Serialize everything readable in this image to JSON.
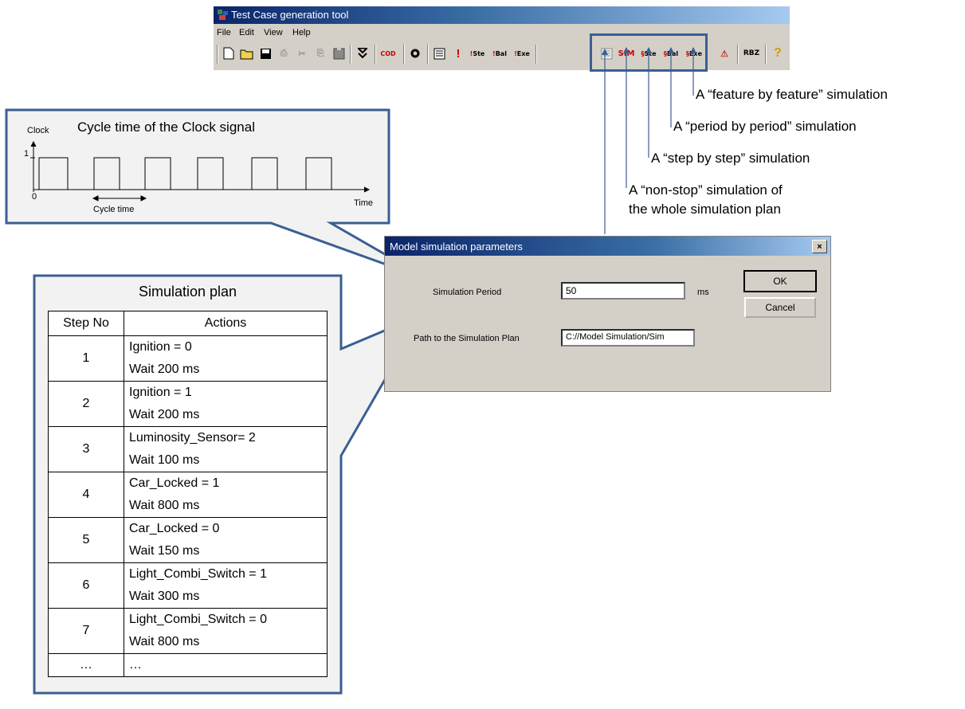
{
  "app": {
    "title": "Test Case generation tool",
    "menu": [
      "File",
      "Edit",
      "View",
      "Help"
    ]
  },
  "toolbar": {
    "icons": [
      {
        "name": "new-icon",
        "label": "🗋"
      },
      {
        "name": "open-icon",
        "label": "📂"
      },
      {
        "name": "save-icon",
        "label": "🖫"
      },
      {
        "name": "print-icon",
        "label": "⎙"
      },
      {
        "name": "cut-icon",
        "label": "✂"
      },
      {
        "name": "copy-icon",
        "label": "⎘"
      },
      {
        "name": "paste-icon",
        "label": "📋"
      },
      {
        "name": "generate-icon",
        "label": "⯯"
      },
      {
        "name": "cod-icon",
        "label": "COD"
      },
      {
        "name": "settings-icon",
        "label": "⚙"
      },
      {
        "name": "list-icon",
        "label": "☰"
      },
      {
        "name": "run-icon",
        "label": "!"
      },
      {
        "name": "run-step-icon",
        "label": "!Ste"
      },
      {
        "name": "run-bal-icon",
        "label": "!Bal"
      },
      {
        "name": "run-exe-icon",
        "label": "!Exe"
      },
      {
        "name": "sim-nonstop-icon",
        "label": "☰"
      },
      {
        "name": "sim-step-icon",
        "label": "SIM"
      },
      {
        "name": "sim-period-icon",
        "label": "§Ste"
      },
      {
        "name": "sim-bal-icon",
        "label": "§Bal"
      },
      {
        "name": "sim-exe-icon",
        "label": "§Exe"
      },
      {
        "name": "warning-icon",
        "label": "⚠"
      },
      {
        "name": "rbz-icon",
        "label": "RBZ"
      },
      {
        "name": "help-icon",
        "label": "?"
      }
    ]
  },
  "annotations": {
    "feature": "A “feature by feature” simulation",
    "period": "A “period by period” simulation",
    "step": "A “step by step” simulation",
    "nonstop_1": "A “non-stop” simulation of",
    "nonstop_2": "the whole simulation plan"
  },
  "clock": {
    "title": "Cycle time of the Clock signal",
    "ylabel": "Clock",
    "tick_high": "1",
    "tick_low": "0",
    "cycle_label": "Cycle time",
    "xlabel": "Time"
  },
  "plan": {
    "title": "Simulation plan",
    "col_step": "Step No",
    "col_actions": "Actions",
    "rows": [
      {
        "step": "1",
        "a1": "Ignition = 0",
        "a2": "Wait 200 ms"
      },
      {
        "step": "2",
        "a1": "Ignition = 1",
        "a2": "Wait 200 ms"
      },
      {
        "step": "3",
        "a1": "Luminosity_Sensor= 2",
        "a2": "Wait 100 ms"
      },
      {
        "step": "4",
        "a1": "Car_Locked  = 1",
        "a2": "Wait 800 ms"
      },
      {
        "step": "5",
        "a1": "Car_Locked  = 0",
        "a2": "Wait 150 ms"
      },
      {
        "step": "6",
        "a1": "Light_Combi_Switch = 1",
        "a2": "Wait 300 ms"
      },
      {
        "step": "7",
        "a1": "Light_Combi_Switch = 0",
        "a2": "Wait 800 ms"
      }
    ],
    "ellipsis_step": "…",
    "ellipsis_action": "…"
  },
  "dialog": {
    "title": "Model simulation parameters",
    "close": "×",
    "period_label": "Simulation Period",
    "period_value": "50",
    "period_unit": "ms",
    "path_label": "Path to the Simulation Plan",
    "path_value": "C://Model Simulation/Sim",
    "ok": "OK",
    "cancel": "Cancel"
  },
  "colors": {
    "callout_border": "#3a5f93",
    "callout_fill": "#f2f2f2",
    "titlebar": "#0a246a"
  }
}
